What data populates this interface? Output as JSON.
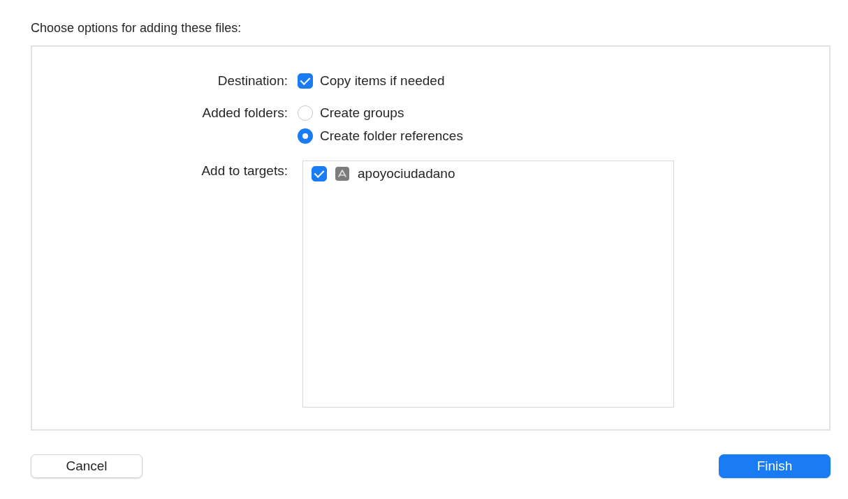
{
  "heading": "Choose options for adding these files:",
  "destination": {
    "label": "Destination:",
    "option": {
      "label": "Copy items if needed",
      "checked": true
    }
  },
  "added_folders": {
    "label": "Added folders:",
    "options": [
      {
        "label": "Create groups",
        "selected": false
      },
      {
        "label": "Create folder references",
        "selected": true
      }
    ]
  },
  "targets": {
    "label": "Add to targets:",
    "items": [
      {
        "name": "apoyociudadano",
        "checked": true
      }
    ]
  },
  "buttons": [
    {
      "label": "Cancel",
      "kind": "secondary"
    },
    {
      "label": "Finish",
      "kind": "primary"
    }
  ]
}
